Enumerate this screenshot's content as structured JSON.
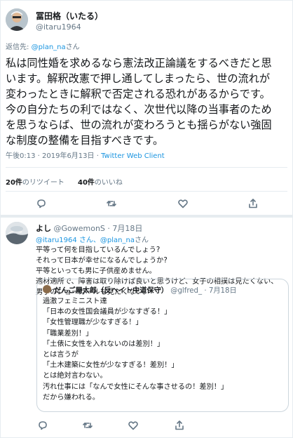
{
  "colors": {
    "link": "#1b95e0",
    "muted": "#657786",
    "text": "#14171a",
    "border": "#e6ecf0"
  },
  "main_tweet": {
    "display_name": "冨田格（いたる）",
    "handle": "@itaru1964",
    "reply_prefix": "返信先:",
    "reply_to": "@plan_na",
    "reply_suffix": "さん",
    "text_lines": [
      "私は同性婚を求めるなら憲法改正論議をするべきだと思",
      "います。解釈改憲で押し通してしまったら、世の流れが",
      "変わったときに解釈で否定される恐れがあるからです。",
      "今の自分たちの利ではなく、次世代以降の当事者のため",
      "を思うならば、世の流れが変わろうとも揺らがない強固",
      "な制度の整備を目指すべきです。"
    ],
    "timestamp": "午後0:13 · 2019年6月13日",
    "separator": " · ",
    "client": "Twitter Web Client",
    "retweet_count": "20件",
    "retweet_label": "のリツイート",
    "like_count": "40件",
    "like_label": "のいいね"
  },
  "icons": [
    "reply-icon",
    "retweet-icon",
    "like-icon",
    "share-icon"
  ],
  "reply_tweet": {
    "display_name": "よし",
    "handle": "@GowemonS",
    "date_sep": " · ",
    "date": "7月18日",
    "reply_to_1": "@itaru1964",
    "reply_mid": " さん、",
    "reply_to_2": "@plan_na",
    "reply_suffix": "さん",
    "text_lines": [
      "平等って何を目指しているんでしょう?",
      "それって日本が幸せになるんでしょうか?",
      "平等といっても男に子供産めません。",
      "適材適所で、障害は取り除けば良いと思うけど、女子の相撲は見たくない、",
      "男子のショーガールも見たくない。"
    ],
    "quote": {
      "display_name": "だんご屋太郎（反ヘイト中道保守）",
      "handle": "@glfred_",
      "date_sep": " · ",
      "date": "7月18日",
      "text_lines": [
        "過激フェミニスト達",
        "「日本の女性国会議員が少なすぎる！」",
        "「女性管理職が少なすぎる！」",
        "「職業差別！」",
        "「土俵に女性を入れないのは差別！」",
        "とは言うが",
        "「土木建築に女性が少なすぎる！差別！」",
        "とは絶対言わない。",
        "汚れ仕事には「なんで女性にそんな事させるの！差別！」",
        "だから嫌われる。"
      ]
    }
  }
}
